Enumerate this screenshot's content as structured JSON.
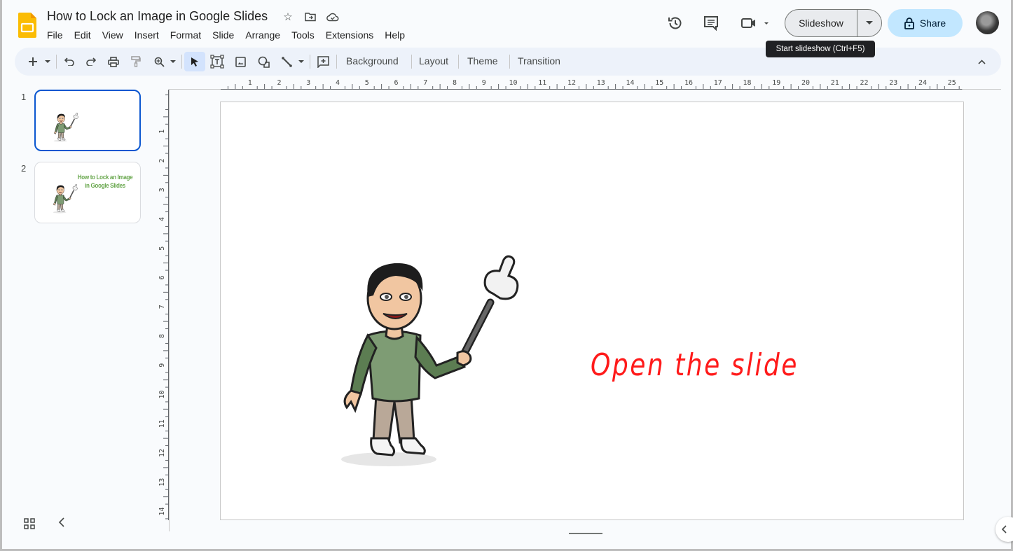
{
  "app": {
    "title": "How to Lock an Image in Google Slides",
    "menu": [
      "File",
      "Edit",
      "View",
      "Insert",
      "Format",
      "Slide",
      "Arrange",
      "Tools",
      "Extensions",
      "Help"
    ],
    "title_icons": [
      "star-icon",
      "move-to-folder-icon",
      "cloud-saved-icon"
    ]
  },
  "header": {
    "slideshow_label": "Slideshow",
    "share_label": "Share",
    "tooltip": "Start slideshow (Ctrl+F5)",
    "icons": [
      "version-history-icon",
      "comments-icon",
      "meet-icon"
    ]
  },
  "toolbar": {
    "background_label": "Background",
    "layout_label": "Layout",
    "theme_label": "Theme",
    "transition_label": "Transition"
  },
  "filmstrip": {
    "slides": [
      {
        "number": "1",
        "selected": true,
        "title_line1": "",
        "title_line2": ""
      },
      {
        "number": "2",
        "selected": false,
        "title_line1": "How to Lock an Image",
        "title_line2": "in Google Slides"
      }
    ]
  },
  "ruler": {
    "horizontal_labels": [
      "1",
      "2",
      "3",
      "4",
      "5",
      "6",
      "7",
      "8",
      "9",
      "10",
      "11",
      "12",
      "13",
      "14",
      "15",
      "16",
      "17",
      "18",
      "19",
      "20",
      "21",
      "22",
      "23",
      "24",
      "25"
    ],
    "vertical_labels": [
      "1",
      "2",
      "3",
      "4",
      "5",
      "6",
      "7",
      "8",
      "9",
      "10",
      "11",
      "12",
      "13",
      "14"
    ]
  },
  "slide": {
    "text": "Open the slide",
    "text_color": "#ff1a1a"
  },
  "colors": {
    "accent": "#0b57d0",
    "share_bg": "#c2e7ff",
    "toolbar_bg": "#edf2fa",
    "thumb_title": "#6aa84f"
  }
}
